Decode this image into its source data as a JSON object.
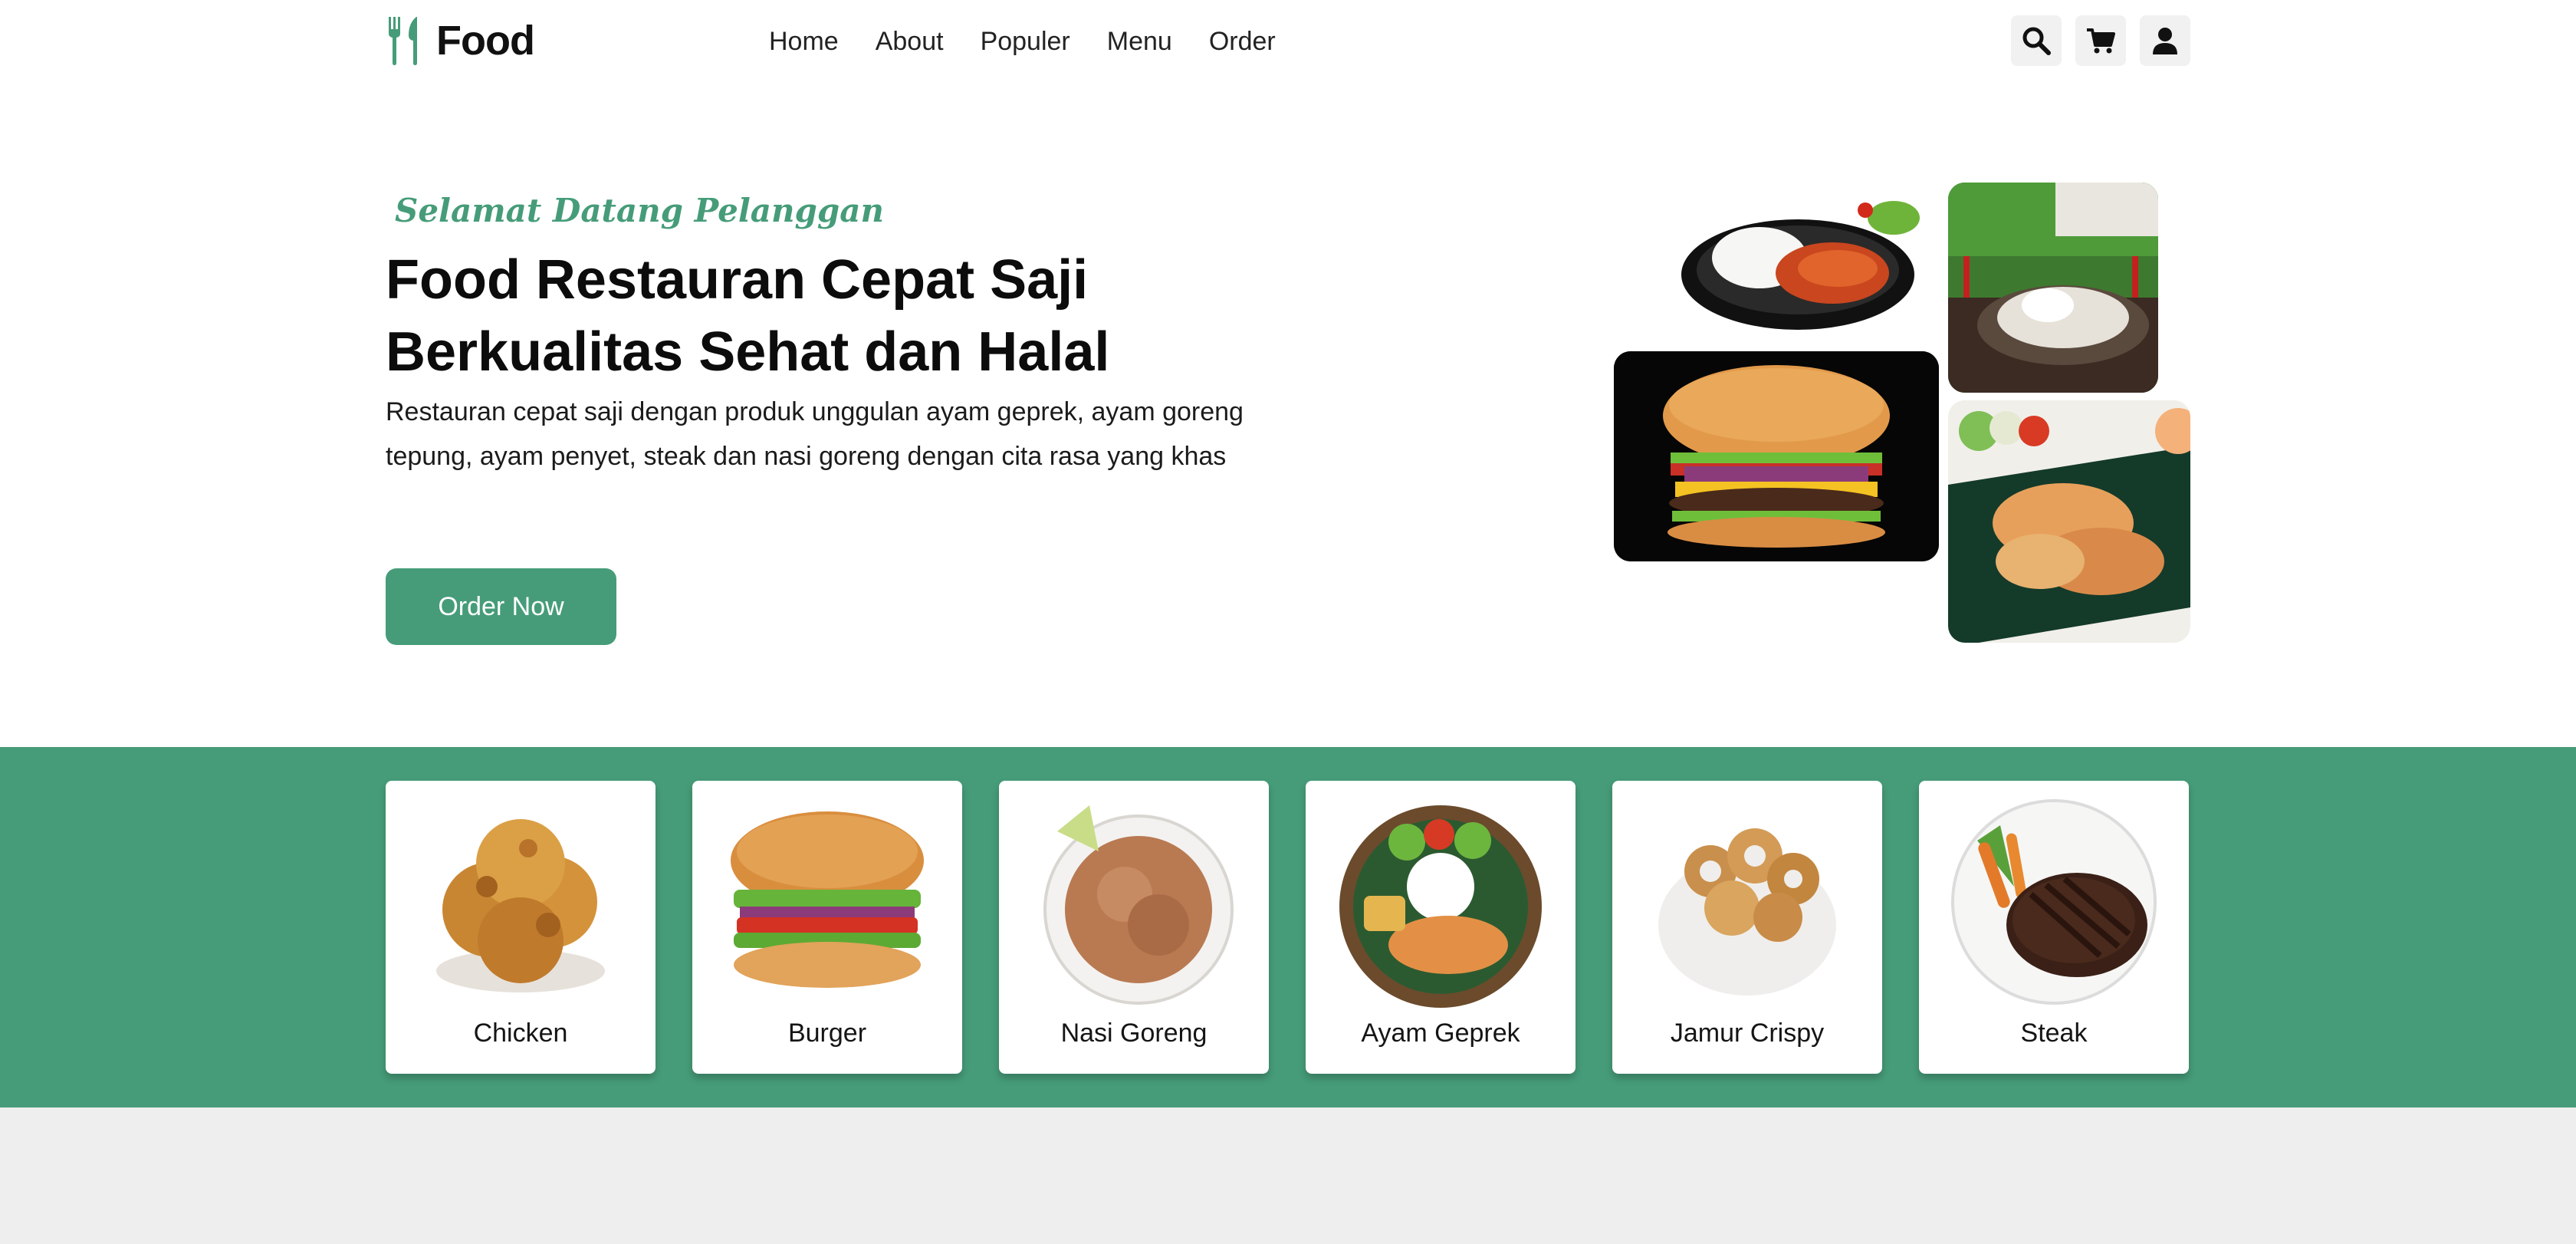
{
  "brand": {
    "name": "Food",
    "accent": "#469c79"
  },
  "nav": {
    "items": [
      "Home",
      "About",
      "Populer",
      "Menu",
      "Order"
    ]
  },
  "actions": {
    "icons": [
      "search-icon",
      "cart-icon",
      "user-icon"
    ]
  },
  "hero": {
    "subtitle": "Selamat Datang Pelanggan",
    "title_line1": "Food Restauran Cepat Saji",
    "title_line2": "Berkualitas Sehat dan Halal",
    "description": "Restauran cepat saji dengan produk unggulan ayam geprek, ayam goreng tepung, ayam penyet, steak dan nasi goreng dengan cita rasa yang khas",
    "cta_label": "Order Now"
  },
  "categories": [
    {
      "label": "Chicken"
    },
    {
      "label": "Burger"
    },
    {
      "label": "Nasi Goreng"
    },
    {
      "label": "Ayam Geprek"
    },
    {
      "label": "Jamur Crispy"
    },
    {
      "label": "Steak"
    }
  ]
}
